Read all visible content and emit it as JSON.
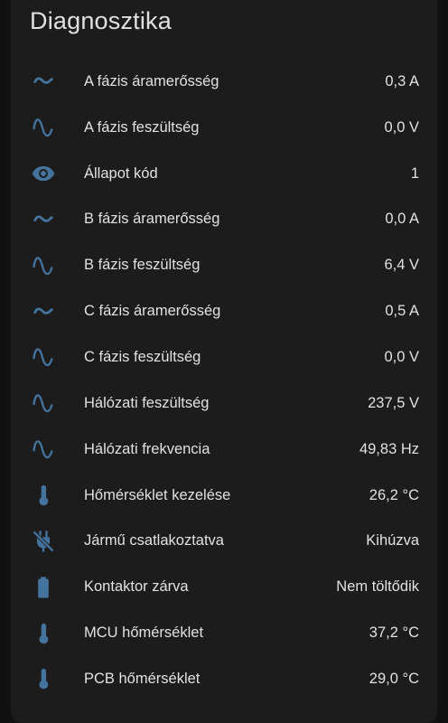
{
  "card": {
    "title": "Diagnosztika"
  },
  "accent_color": "#44739e",
  "rows": [
    {
      "icon": "current-ac-icon",
      "label": "A fázis áramerősség",
      "value": "0,3 A"
    },
    {
      "icon": "sine-wave-icon",
      "label": "A fázis feszültség",
      "value": "0,0 V"
    },
    {
      "icon": "eye-icon",
      "label": "Állapot kód",
      "value": "1"
    },
    {
      "icon": "current-ac-icon",
      "label": "B fázis áramerősség",
      "value": "0,0 A"
    },
    {
      "icon": "sine-wave-icon",
      "label": "B fázis feszültség",
      "value": "6,4 V"
    },
    {
      "icon": "current-ac-icon",
      "label": "C fázis áramerősség",
      "value": "0,5 A"
    },
    {
      "icon": "sine-wave-icon",
      "label": "C fázis feszültség",
      "value": "0,0 V"
    },
    {
      "icon": "sine-wave-icon",
      "label": "Hálózati feszültség",
      "value": "237,5 V"
    },
    {
      "icon": "sine-wave-icon",
      "label": "Hálózati frekvencia",
      "value": "49,83 Hz"
    },
    {
      "icon": "thermometer-icon",
      "label": "Hőmérséklet kezelése",
      "value": "26,2 °C"
    },
    {
      "icon": "power-plug-off-icon",
      "label": "Jármű csatlakoztatva",
      "value": "Kihúzva"
    },
    {
      "icon": "battery-icon",
      "label": "Kontaktor zárva",
      "value": "Nem töltődik"
    },
    {
      "icon": "thermometer-icon",
      "label": "MCU hőmérséklet",
      "value": "37,2 °C"
    },
    {
      "icon": "thermometer-icon",
      "label": "PCB hőmérséklet",
      "value": "29,0 °C"
    }
  ]
}
